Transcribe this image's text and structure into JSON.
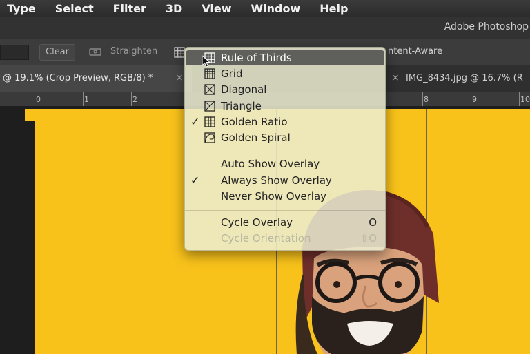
{
  "menubar": {
    "items": [
      "Type",
      "Select",
      "Filter",
      "3D",
      "View",
      "Window",
      "Help"
    ]
  },
  "app_title": "Adobe Photoshop",
  "options_bar": {
    "clear_label": "Clear",
    "straighten_label": "Straighten",
    "content_aware_label": "ntent-Aware"
  },
  "tabs": {
    "active_label": "@ 19.1% (Crop Preview, RGB/8) *",
    "active_close": "×",
    "second_label": "IMG_8434.jpg @ 16.7% (R",
    "second_close": "×"
  },
  "ruler": {
    "ticks": [
      "0",
      "1",
      "2",
      "8",
      "9",
      "10"
    ]
  },
  "overlay_menu": {
    "items": [
      {
        "label": "Rule of Thirds",
        "icon": "rule-of-thirds-icon",
        "checked": false,
        "highlighted": true
      },
      {
        "label": "Grid",
        "icon": "grid-icon",
        "checked": false
      },
      {
        "label": "Diagonal",
        "icon": "diagonal-icon",
        "checked": false
      },
      {
        "label": "Triangle",
        "icon": "triangle-icon",
        "checked": false
      },
      {
        "label": "Golden Ratio",
        "icon": "golden-ratio-icon",
        "checked": true
      },
      {
        "label": "Golden Spiral",
        "icon": "golden-spiral-icon",
        "checked": false
      }
    ],
    "show_options": [
      {
        "label": "Auto Show Overlay",
        "checked": false
      },
      {
        "label": "Always Show Overlay",
        "checked": true
      },
      {
        "label": "Never Show Overlay",
        "checked": false
      }
    ],
    "cycle": [
      {
        "label": "Cycle Overlay",
        "shortcut": "O",
        "disabled": false
      },
      {
        "label": "Cycle Orientation",
        "shortcut": "⇧O",
        "disabled": true
      }
    ],
    "check_glyph": "✓"
  },
  "colors": {
    "photo_bg": "#f8c21b",
    "menu_bg": "#ececd2",
    "beanie": "#6e2f2a",
    "skin": "#d9a27c",
    "beard": "#2b211c"
  }
}
